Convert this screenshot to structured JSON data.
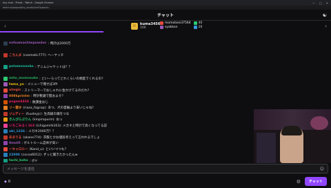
{
  "window": {
    "title": "kuy chat - Privat - Twitch - Google Chrome",
    "url": "twitch.tv/popout/kuy_studio/chat?popout=",
    "controls": [
      "—",
      "□",
      "✕"
    ]
  },
  "header": {
    "title": "チャット",
    "people_icon": "users-icon"
  },
  "leaderboard": {
    "top": {
      "name": "kuma34565",
      "points": "100"
    },
    "others": [
      {
        "name": "momotaro37564",
        "value": "40",
        "color": "#2ecc71"
      },
      {
        "name": "syakkon",
        "value": "20",
        "color": "#3498db"
      }
    ]
  },
  "messages": [
    {
      "user": "",
      "color": "#bfbfc7",
      "text": "",
      "icon": "#555"
    },
    {
      "user": "nofuamachiwpuwduc",
      "color": "#9b59b6",
      "text": ": 時計は2000万",
      "icon": "#2c3e50"
    },
    {
      "user": "",
      "color": "#bfbfc7",
      "text": "",
      "icon": "#555"
    },
    {
      "user": "こちんま",
      "color": "#e74c3c",
      "text": "(cosmatic777): ヘーヤッチ",
      "icon": "#c0392b"
    },
    {
      "user": "",
      "color": "#bfbfc7",
      "text": "",
      "icon": "#555"
    },
    {
      "user": "petamnnnnko",
      "color": "#1abc9c",
      "text": ": デニムジャケットは？？",
      "icon": "#16a085"
    },
    {
      "user": "",
      "color": "#bfbfc7",
      "text": "",
      "icon": "#555"
    },
    {
      "user": "mitu_momosuke",
      "color": "#27ae60",
      "text": ": どいーらってどれくらいの頻度でくれるの？",
      "icon": "#2ecc71"
    },
    {
      "user": "tamu_yo",
      "color": "#f1c40f",
      "text": ": メニューで俺せば3PI",
      "icon": "#9b59b6"
    },
    {
      "user": "ulmgiz",
      "color": "#e74c3c",
      "text": ": ストリーマーでおしゃれに金かけてるのだれ？",
      "icon": "#e74c3c"
    },
    {
      "user": "008kprintm",
      "color": "#e67e22",
      "text": ": 時計靴鋸で握およそ？",
      "icon": "#8e44ad"
    },
    {
      "user": "pogon4434",
      "color": "#e91e63",
      "text": ": 敗課金おじ",
      "icon": "#d35400"
    },
    {
      "user": "リー雲ゆ",
      "color": "#e67e22",
      "text": "(riaxa_fogcap): あつ、犬の首輪より安いじゃね？",
      "icon": "#e67e22"
    },
    {
      "user": "ジュディー",
      "color": "#e74c3c",
      "text": "(fuudeyjc): 生高級の踊をつな",
      "icon": "#c0392b"
    },
    {
      "user": "きんぴらぷりん",
      "color": "#2ecc71",
      "text": "(kinpirapurin): おっ",
      "icon": "#f39c12"
    },
    {
      "user": "いちごみるく163",
      "color": "#e91e63",
      "text": "(ichigomilk163): メガネと時計で高くなってる説",
      "icon": "#e84393"
    },
    {
      "user": "obi_1226",
      "color": "#3498db",
      "text": ": メガネ2000万？？",
      "icon": "#2980b9"
    },
    {
      "user": "あまりる",
      "color": "#e74c3c",
      "text": "(akane774): 衣服とかお値段考えって言われるでしょ",
      "icon": "#c0392b"
    },
    {
      "user": "0mot0",
      "color": "#9b59b6",
      "text": ": ボルトルーム自体が高い",
      "icon": "#8e44ad"
    },
    {
      "user": "ーキャロルー",
      "color": "#e74c3c",
      "text": "(Karol_u): といいつつも？",
      "icon": "#e74c3c"
    },
    {
      "user": "22900",
      "color": "#3498db",
      "text": "(cocoa6012): ずっと聞きたかったんw",
      "icon": "#2980b9"
    },
    {
      "user": "tachi_koho",
      "color": "#2ecc71",
      "text": ": ボド",
      "icon": "#16a085"
    }
  ],
  "input": {
    "placeholder": "メッセージを送信",
    "emoji_icon": "smile-icon"
  },
  "footer": {
    "points_value": "0",
    "send_label": "チャット",
    "settings_icon": "gear-icon"
  }
}
